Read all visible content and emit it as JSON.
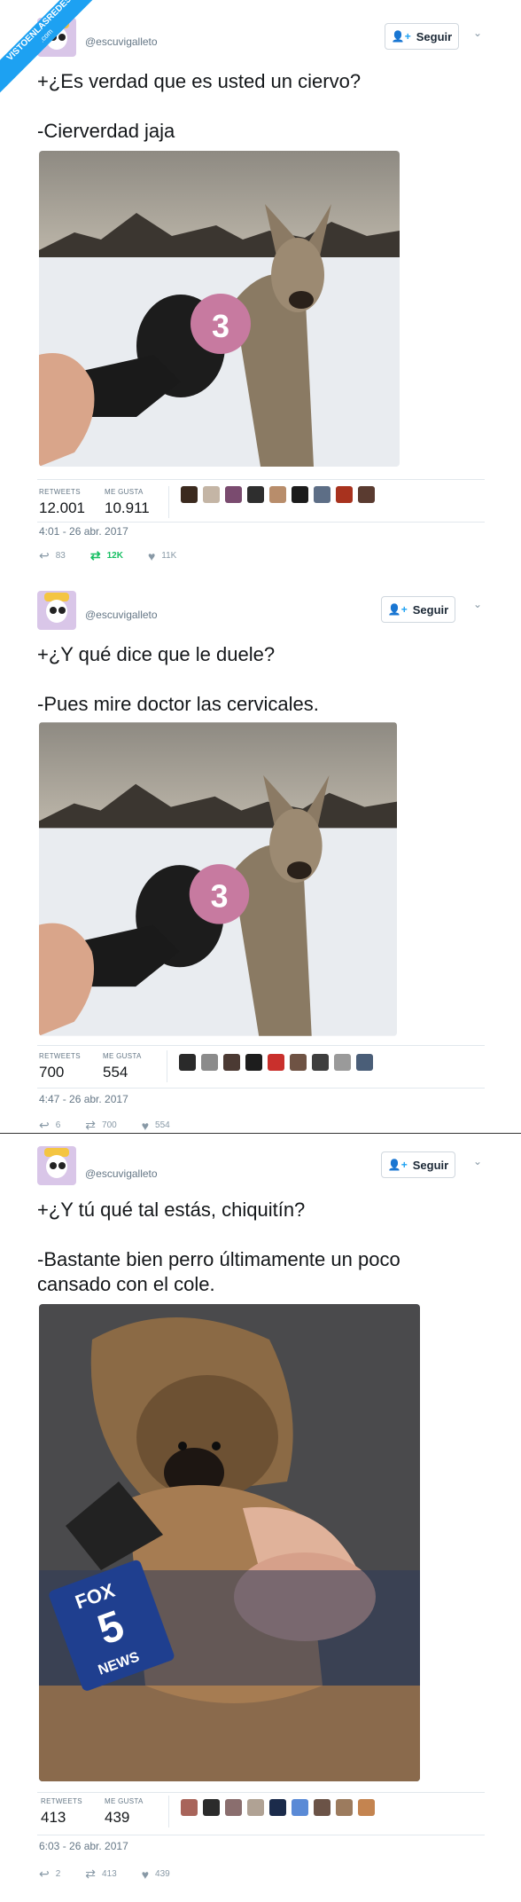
{
  "watermark": {
    "line1": "VISTOENLASREDES",
    "line2": ".com"
  },
  "tweets": [
    {
      "handle": "@escuvigalleto",
      "follow_label": "Seguir",
      "text": "+¿Es verdad que es usted un ciervo?\n\n-Cierverdad jaja",
      "stats": {
        "retweets_label": "RETWEETS",
        "retweets": "12.001",
        "likes_label": "ME GUSTA",
        "likes": "10.911"
      },
      "date": "4:01 - 26 abr. 2017",
      "actions": {
        "replies": "83",
        "retweets": "12K",
        "likes": "11K"
      }
    },
    {
      "handle": "@escuvigalleto",
      "follow_label": "Seguir",
      "text": "+¿Y qué dice que le duele?\n\n-Pues mire doctor las cervicales.",
      "stats": {
        "retweets_label": "RETWEETS",
        "retweets": "700",
        "likes_label": "ME GUSTA",
        "likes": "554"
      },
      "date": "4:47 - 26 abr. 2017",
      "actions": {
        "replies": "6",
        "retweets": "700",
        "likes": "554"
      }
    },
    {
      "handle": "@escuvigalleto",
      "follow_label": "Seguir",
      "text": "+¿Y tú qué tal estás, chiquitín?\n\n-Bastante bien perro últimamente un poco\ncansado con el cole.",
      "stats": {
        "retweets_label": "RETWEETS",
        "retweets": "413",
        "likes_label": "ME GUSTA",
        "likes": "439"
      },
      "date": "6:03 - 26 abr. 2017",
      "actions": {
        "replies": "2",
        "retweets": "413",
        "likes": "439"
      }
    }
  ],
  "images": {
    "mic_logo": "3",
    "fox_logo": "FOX",
    "fox_number": "5",
    "fox_news": "NEWS"
  },
  "icons": {
    "follow": "add-user-icon",
    "caret": "chevron-down-icon",
    "reply": "reply-icon",
    "retweet": "retweet-icon",
    "like": "heart-icon"
  },
  "colors": {
    "accent": "#1da1f2",
    "retweet_active": "#17bf63",
    "muted": "#657786"
  }
}
